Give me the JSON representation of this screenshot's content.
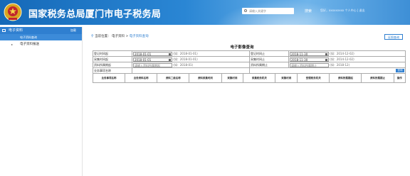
{
  "header": {
    "title": "国家税务总局厦门市电子税务局",
    "search_placeholder": "请输入关键字",
    "search_label": "搜索",
    "welcome": "您好，xxxxxxxxx 个人中心 | 退出"
  },
  "sidebar": {
    "section_label": "电子资料",
    "section_right": "加载",
    "active_item": "电子资料查询",
    "items": [
      {
        "label": "电子资料报送"
      }
    ]
  },
  "breadcrumb": {
    "prefix": "当前位置：",
    "parent": "电子资料",
    "sep": " > ",
    "current": "电子资料查询"
  },
  "top_button": "证照查询",
  "section_title": "电子影像查询",
  "form": {
    "row1": {
      "l_label": "登记时间起",
      "l_value": "2018-01-01",
      "l_hint": "(如：2018-01-01)",
      "r_label": "登记时间止",
      "r_value": "2018-11-30",
      "r_hint": "(如：2014-12-02)"
    },
    "row2": {
      "l_label": "采集时间起",
      "l_value": "2018-01-01",
      "l_hint": "(如：2018-01-01)",
      "r_label": "采集时间止",
      "r_value": "2018-11-30",
      "r_hint": "(如：2014-12-02)"
    },
    "row3": {
      "l_label": "资料所属期起",
      "l_value": "请输入资料所属期起",
      "l_hint": "(如：2018-01)",
      "r_label": "资料所属期止",
      "r_value": "请输入资料所属期止",
      "r_hint": "(如：2018-12)"
    },
    "row4": {
      "label": "业务事项名称"
    },
    "query_button": "查询"
  },
  "table": {
    "columns": [
      "业务事项名称",
      "业务资料名称",
      "资料二级名称",
      "资料采集时间",
      "采集时间",
      "采集税务机关",
      "采集时间",
      "受理税务机关",
      "资料所属期起",
      "资料所属期止",
      "操作"
    ]
  }
}
